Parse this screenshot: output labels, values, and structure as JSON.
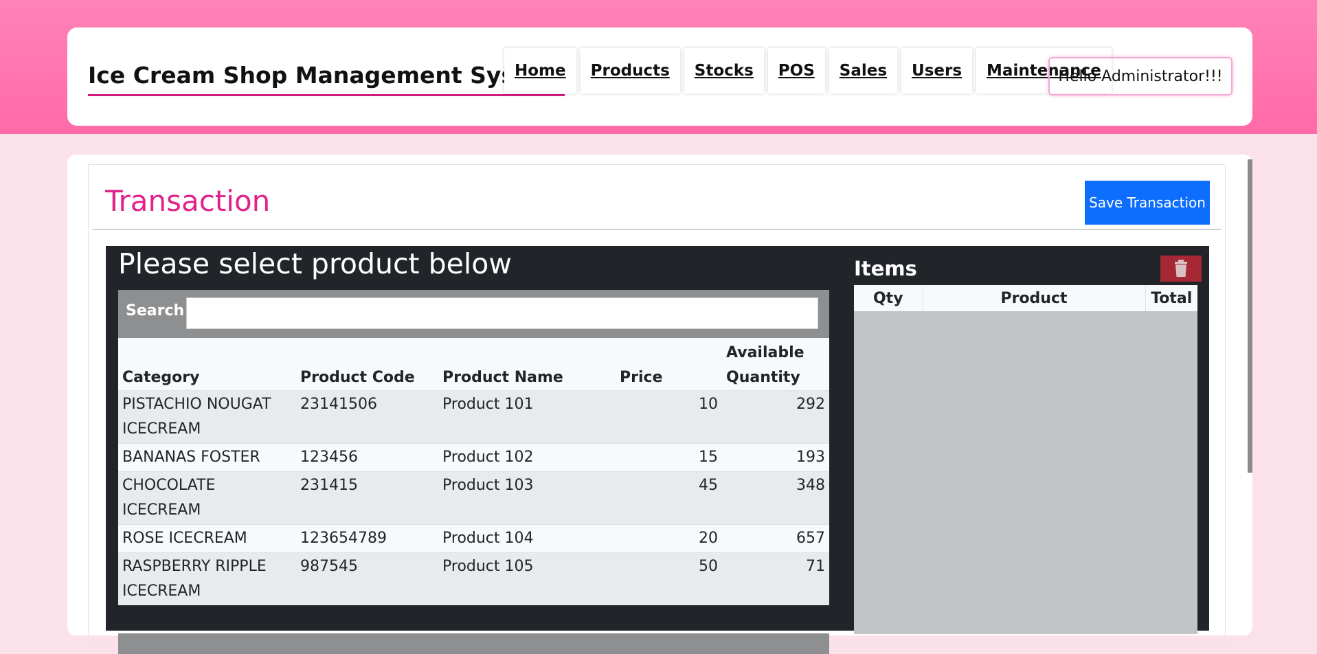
{
  "header": {
    "brand": "Ice Cream Shop Management System",
    "nav": [
      "Home",
      "Products",
      "Stocks",
      "POS",
      "Sales",
      "Users",
      "Maintenance"
    ],
    "greeting": "Hello Administrator!!!"
  },
  "page": {
    "title": "Transaction",
    "save_label": "Save Transaction"
  },
  "product_panel": {
    "heading": "Please select product below",
    "search_label": "Search",
    "search_value": "",
    "columns": {
      "category": "Category",
      "code": "Product Code",
      "name": "Product Name",
      "price": "Price",
      "qty": "Available Quantity"
    },
    "rows": [
      {
        "category": "PISTACHIO NOUGAT ICECREAM",
        "code": "23141506",
        "name": "Product 101",
        "price": "10",
        "qty": "292"
      },
      {
        "category": "BANANAS FOSTER",
        "code": "123456",
        "name": "Product 102",
        "price": "15",
        "qty": "193"
      },
      {
        "category": "CHOCOLATE ICECREAM",
        "code": "231415",
        "name": "Product 103",
        "price": "45",
        "qty": "348"
      },
      {
        "category": "ROSE ICECREAM",
        "code": "123654789",
        "name": "Product 104",
        "price": "20",
        "qty": "657"
      },
      {
        "category": "RASPBERRY RIPPLE ICECREAM",
        "code": "987545",
        "name": "Product 105",
        "price": "50",
        "qty": "71"
      }
    ]
  },
  "items_panel": {
    "title": "Items",
    "columns": {
      "qty": "Qty",
      "product": "Product",
      "total": "Total"
    },
    "clear_icon": "trash-icon"
  },
  "colors": {
    "brand_pink": "#e0228a",
    "header_band": "#ff78b2",
    "primary_button": "#0d6efd",
    "danger_button": "#a52834"
  }
}
